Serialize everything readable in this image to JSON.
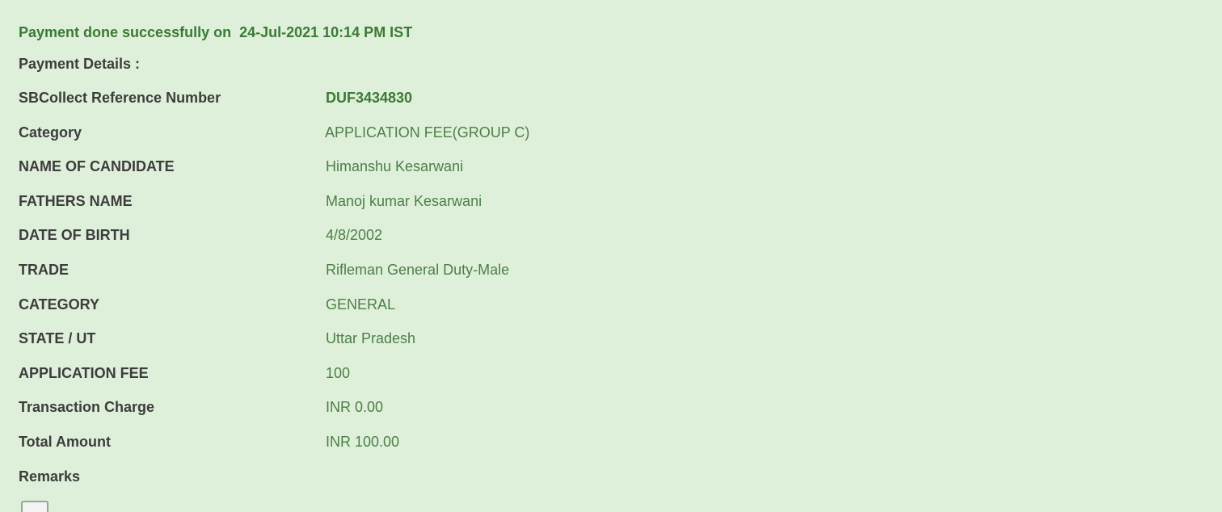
{
  "status": {
    "message": "Payment done successfully on  24-Jul-2021 10:14 PM IST"
  },
  "details": {
    "heading": "Payment Details :",
    "rows": [
      {
        "label": "SBCollect Reference Number",
        "value": "DUF3434830"
      },
      {
        "label": "Category",
        "value": "APPLICATION FEE(GROUP C)"
      },
      {
        "label": "NAME OF CANDIDATE",
        "value": "Himanshu Kesarwani"
      },
      {
        "label": "FATHERS NAME",
        "value": "Manoj kumar Kesarwani"
      },
      {
        "label": "DATE OF BIRTH",
        "value": "4/8/2002"
      },
      {
        "label": "TRADE",
        "value": "Rifleman General Duty-Male"
      },
      {
        "label": "CATEGORY",
        "value": "GENERAL"
      },
      {
        "label": "STATE / UT",
        "value": "Uttar Pradesh"
      },
      {
        "label": "APPLICATION FEE",
        "value": "100"
      },
      {
        "label": "Transaction Charge",
        "value": "INR 0.00"
      },
      {
        "label": "Total Amount",
        "value": "INR 100.00"
      },
      {
        "label": "Remarks",
        "value": ""
      }
    ]
  },
  "icons": {
    "print": "print-icon"
  },
  "colors": {
    "background": "#dff0da",
    "success_text": "#3a7a34",
    "label_text": "#3c3c3c",
    "value_text": "#4c7e47"
  }
}
